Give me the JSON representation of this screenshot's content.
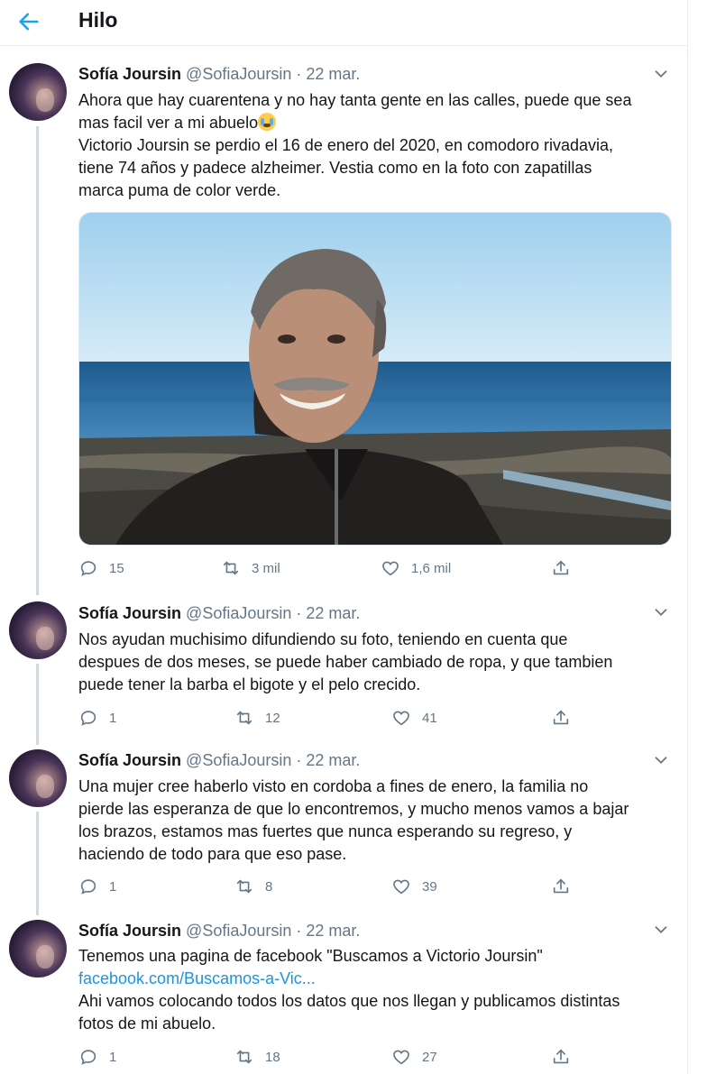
{
  "header": {
    "title": "Hilo"
  },
  "tweets": [
    {
      "name": "Sofía Joursin",
      "handle": "@SofiaJoursin",
      "sep": "·",
      "date": "22 mar.",
      "text": [
        "Ahora que hay cuarentena y no hay tanta gente en las calles, puede que sea",
        "mas facil ver a mi abuelo",
        "Victorio Joursin se perdio el 16 de enero del 2020, en comodoro rivadavia,",
        "tiene 74 años y padece alzheimer. Vestia como en la foto con zapatillas",
        "marca puma de color verde."
      ],
      "emoji": "loudly-crying-face",
      "replies": "15",
      "retweets": "3 mil",
      "likes": "1,6 mil"
    },
    {
      "name": "Sofía Joursin",
      "handle": "@SofiaJoursin",
      "sep": "·",
      "date": "22 mar.",
      "text": [
        "Nos ayudan muchisimo difundiendo su foto, teniendo en cuenta que",
        "despues de dos meses, se puede haber cambiado de ropa, y que tambien",
        "puede tener la barba el bigote y el pelo crecido."
      ],
      "replies": "1",
      "retweets": "12",
      "likes": "41"
    },
    {
      "name": "Sofía Joursin",
      "handle": "@SofiaJoursin",
      "sep": "·",
      "date": "22 mar.",
      "text": [
        "Una mujer cree haberlo visto en cordoba a fines de enero, la familia no",
        "pierde las esperanza de que lo encontremos, y mucho menos vamos a bajar",
        "los brazos, estamos mas fuertes que nunca esperando su regreso, y",
        "haciendo de todo para que eso pase."
      ],
      "replies": "1",
      "retweets": "8",
      "likes": "39"
    },
    {
      "name": "Sofía Joursin",
      "handle": "@SofiaJoursin",
      "sep": "·",
      "date": "22 mar.",
      "text": [
        "Tenemos una pagina de facebook \"Buscamos a Victorio Joursin\"",
        "facebook.com/Buscamos-a-Vic...",
        "Ahi vamos colocando todos los datos que nos llegan y publicamos distintas",
        "fotos de mi abuelo."
      ],
      "replies": "1",
      "retweets": "18",
      "likes": "27"
    }
  ],
  "colors": {
    "accent": "#1da1f2",
    "link": "#1b95e0",
    "muted": "#657786",
    "text": "#14171a",
    "thread_line": "#cfd9de"
  }
}
